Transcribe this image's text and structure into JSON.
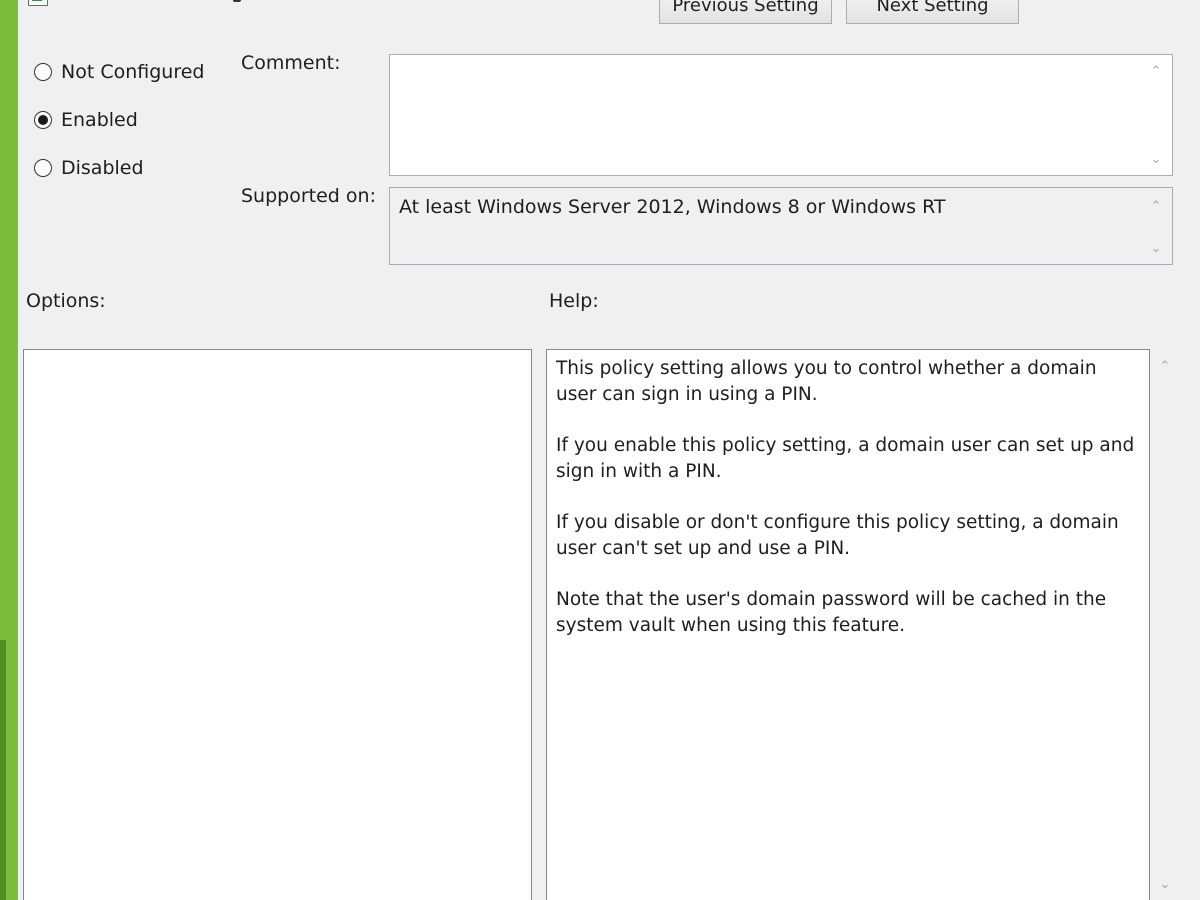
{
  "toolbar": {
    "previous_label": "Previous Setting",
    "next_label": "Next Setting"
  },
  "state": {
    "options": [
      {
        "label": "Not Configured",
        "selected": false
      },
      {
        "label": "Enabled",
        "selected": true
      },
      {
        "label": "Disabled",
        "selected": false
      }
    ]
  },
  "comment": {
    "label": "Comment:",
    "value": ""
  },
  "supported": {
    "label": "Supported on:",
    "value": "At least Windows Server 2012, Windows 8 or Windows RT"
  },
  "options_section": {
    "label": "Options:"
  },
  "help_section": {
    "label": "Help:",
    "paragraphs": [
      "This policy setting allows you to control whether a domain user can sign in using a PIN.",
      "If you enable this policy setting, a domain user can set up and sign in with a PIN.",
      "If you disable or don't configure this policy setting, a domain user can't set up and use a PIN.",
      "Note that the user's domain password will be cached in the system vault when using this feature."
    ]
  },
  "icons": {
    "scroll_up": "scroll-up-icon",
    "scroll_down": "scroll-down-icon",
    "window": "policy-window-icon"
  },
  "colors": {
    "frame_accent": "#7cbe3a",
    "dialog_background": "#f0f0f0"
  }
}
